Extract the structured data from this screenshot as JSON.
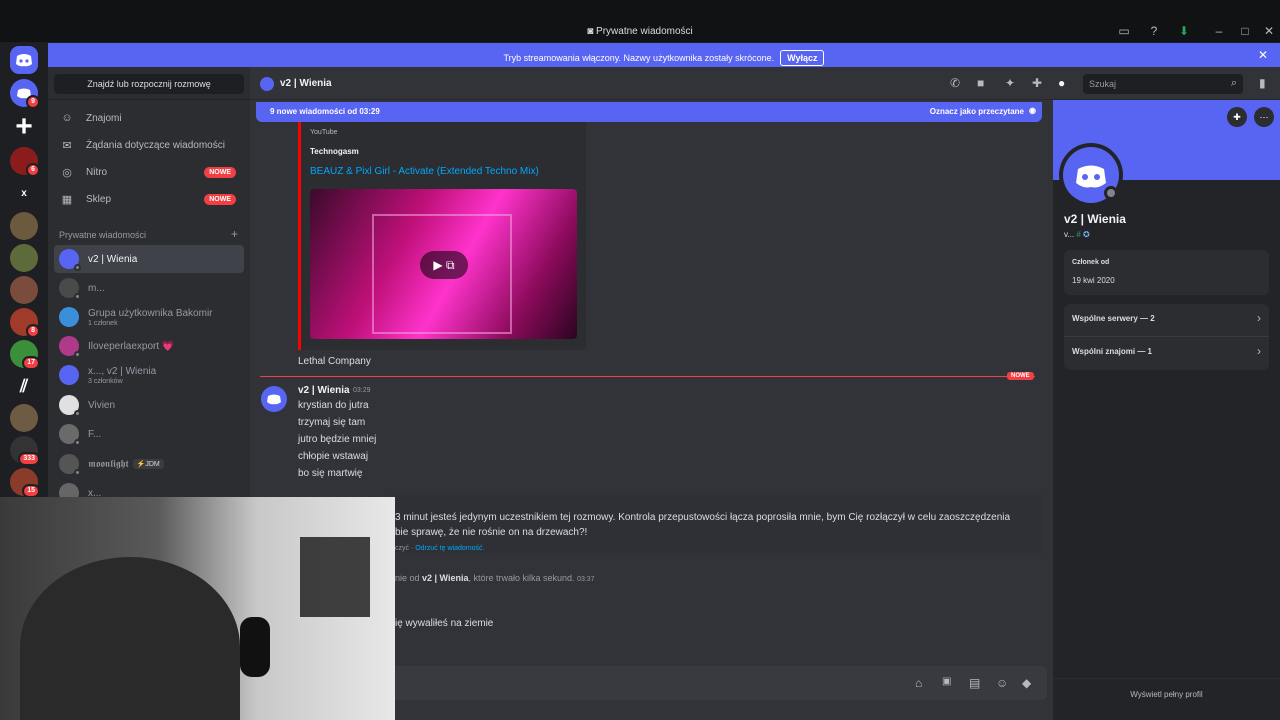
{
  "window": {
    "title": "Prywatne wiadomości"
  },
  "banner": {
    "text": "Tryb streamowania włączony. Nazwy użytkownika zostały skrócone.",
    "button": "Wyłącz"
  },
  "rail": {
    "servers": [
      {
        "name": "discord-home",
        "badge": ""
      },
      {
        "name": "dm-avatar",
        "badge": "9"
      },
      {
        "name": "add-server",
        "badge": ""
      },
      {
        "name": "server-red",
        "badge": "6"
      },
      {
        "name": "server-x",
        "badge": ""
      },
      {
        "name": "server-1",
        "badge": ""
      },
      {
        "name": "server-2",
        "badge": ""
      },
      {
        "name": "server-3",
        "badge": ""
      },
      {
        "name": "server-nico",
        "badge": "8"
      },
      {
        "name": "server-green",
        "badge": "17"
      },
      {
        "name": "server-white",
        "badge": ""
      },
      {
        "name": "server-4",
        "badge": ""
      },
      {
        "name": "server-5",
        "badge": "333"
      },
      {
        "name": "server-6",
        "badge": "15"
      }
    ],
    "x_label": "x"
  },
  "dm_sidebar": {
    "search": "Znajdź lub rozpocznij rozmowę",
    "nav": [
      {
        "label": "Znajomi",
        "icon": "friends-icon",
        "tag": ""
      },
      {
        "label": "Żądania dotyczące wiadomości",
        "icon": "mail-icon",
        "tag": ""
      },
      {
        "label": "Nitro",
        "icon": "nitro-icon",
        "tag": "NOWE"
      },
      {
        "label": "Sklep",
        "icon": "shop-icon",
        "tag": "NOWE"
      }
    ],
    "section": "Prywatne wiadomości",
    "dms": [
      {
        "name": "v2 | Wienia",
        "sub": ""
      },
      {
        "name": "m...",
        "sub": ""
      },
      {
        "name": "Grupa użytkownika Bakomir",
        "sub": "1 członek"
      },
      {
        "name": "Iloveperlaexport 💗",
        "sub": ""
      },
      {
        "name": "x..., v2 | Wienia",
        "sub": "3 członków"
      },
      {
        "name": "Vivien",
        "sub": ""
      },
      {
        "name": "F...",
        "sub": ""
      },
      {
        "name": "𝖒𝖔𝖔𝖓𝖑𝖎𝖌𝖍𝖙",
        "sub": "",
        "tag": "JDM"
      },
      {
        "name": "x...",
        "sub": ""
      }
    ]
  },
  "header": {
    "channel": "v2 | Wienia",
    "search_placeholder": "Szukaj"
  },
  "chat": {
    "new_messages": "9 nowe wiadomości od 03:29",
    "mark_read": "Oznacz jako przeczytane",
    "embed": {
      "provider": "YouTube",
      "author": "Technogasm",
      "title": "BEAUZ & Pixl Girl - Activate (Extended Techno Mix)"
    },
    "prev_text": "Lethal Company",
    "new_tag": "NOWE",
    "message": {
      "author": "v2 | Wienia",
      "time": "03:29",
      "lines": [
        "krystian do jutra",
        "trzymaj się tam",
        "jutro będzie mniej",
        "chłopie wstawaj",
        "bo się martwię"
      ]
    },
    "system": {
      "line1": "3 minut jesteś jedynym uczestnikiem tej rozmowy. Kontrola przepustowości łącza poprosiła mnie, bym Cię rozłączył w celu zaoszczędzenia",
      "line2": "bie sprawę, że nie rośnie on na drzewach?!",
      "action_prefix": "czyć · ",
      "action": "Odrzuć tę wiadomość."
    },
    "call": {
      "prefix": "nie od ",
      "who": "v2 | Wienia",
      "suffix": ", które trwało kilka sekund.",
      "time": "03:37"
    },
    "last": "ię wywaliłeś na ziemie"
  },
  "profile": {
    "name": "v2 | Wienia",
    "tag": "v...",
    "member_since_label": "Członek od",
    "member_since": "19 kwi 2020",
    "mutual_servers": "Wspólne serwery — 2",
    "mutual_friends": "Wspólni znajomi — 1",
    "full_profile": "Wyświetl pełny profil"
  },
  "colors": {
    "accent": "#5865f2",
    "badge": "#f23f43",
    "link": "#00a8fc",
    "pink": "#e0008a"
  }
}
